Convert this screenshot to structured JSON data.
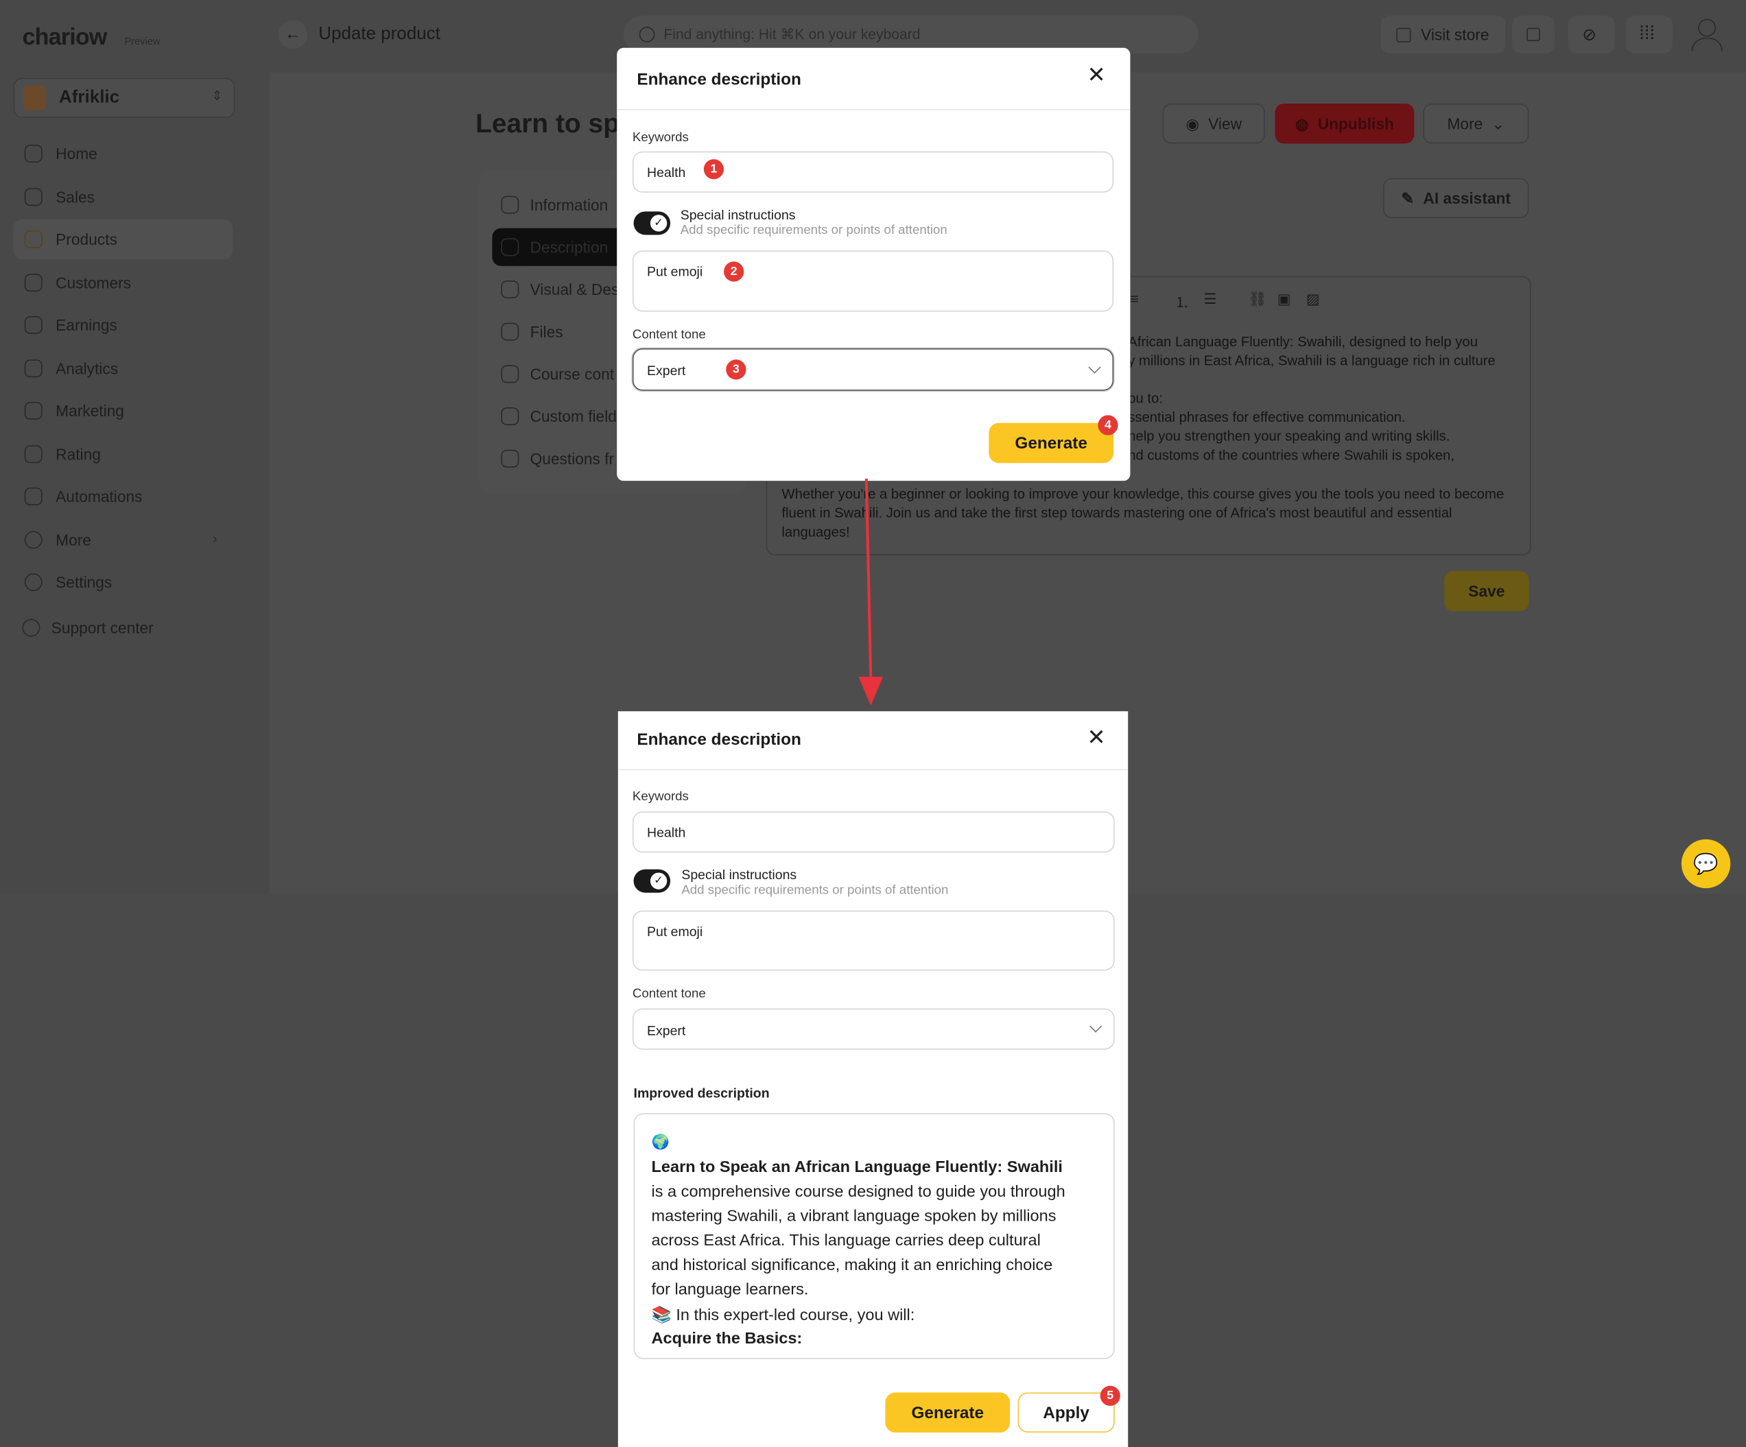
{
  "app": {
    "logo": "chariow",
    "logo_tag": "Preview",
    "store_name": "Afriklic",
    "page_header": "Update product",
    "search_placeholder": "Find anything: Hit ⌘K on your keyboard",
    "visit_store": "Visit store",
    "nav": [
      {
        "label": "Home",
        "icon": "home-icon"
      },
      {
        "label": "Sales",
        "icon": "sales-icon"
      },
      {
        "label": "Products",
        "icon": "box-icon"
      },
      {
        "label": "Customers",
        "icon": "users-icon"
      },
      {
        "label": "Earnings",
        "icon": "earnings-icon"
      },
      {
        "label": "Analytics",
        "icon": "chart-icon"
      },
      {
        "label": "Marketing",
        "icon": "megaphone-icon"
      },
      {
        "label": "Rating",
        "icon": "rating-icon"
      },
      {
        "label": "Automations",
        "icon": "bolt-icon"
      },
      {
        "label": "More",
        "icon": "more-icon"
      },
      {
        "label": "Settings",
        "icon": "gear-icon"
      }
    ],
    "support": "Support center",
    "product_title": "Learn to spe",
    "view_button": "View",
    "unpublish_button": "Unpublish",
    "more_button": "More",
    "ai_assistant": "AI assistant",
    "tabs": [
      {
        "label": "Information"
      },
      {
        "label": "Description"
      },
      {
        "label": "Visual & Des"
      },
      {
        "label": "Files"
      },
      {
        "label": "Course cont"
      },
      {
        "label": "Custom field"
      },
      {
        "label": "Questions fr"
      }
    ],
    "editor_lines": [
      "African Language Fluently: Swahili, designed to help you",
      "y millions in East Africa, Swahili is a language rich in culture",
      "ou to:",
      "ssential phrases for effective communication.",
      "help you strengthen your speaking and writing skills.",
      "nd customs of the countries where Swahili is spoken,",
      "Whether you're a beginner or looking to improve your knowledge, this course gives you the tools you need to become",
      "fluent in Swahili. Join us and take the first step towards mastering one of Africa's most beautiful and essential",
      "languages!"
    ],
    "save_button": "Save"
  },
  "modal1": {
    "title": "Enhance description",
    "keywords_label": "Keywords",
    "keywords_value": "Health",
    "special_title": "Special instructions",
    "special_sub": "Add specific requirements or points of attention",
    "instructions_value": "Put emoji",
    "tone_label": "Content tone",
    "tone_value": "Expert",
    "generate_button": "Generate",
    "markers": [
      "1",
      "2",
      "3",
      "4"
    ]
  },
  "modal2": {
    "title": "Enhance description",
    "keywords_label": "Keywords",
    "keywords_value": "Health",
    "special_title": "Special instructions",
    "special_sub": "Add specific requirements or points of attention",
    "instructions_value": "Put emoji",
    "tone_label": "Content tone",
    "tone_value": "Expert",
    "improved_label": "Improved description",
    "improved_lines": [
      "🌍",
      "Learn to Speak an African Language Fluently: Swahili",
      "is a comprehensive course designed to guide you through",
      "mastering Swahili, a vibrant language spoken by millions",
      "across East Africa. This language carries deep cultural",
      "and historical significance, making it an enriching choice",
      "for language learners.",
      "📚 In this expert-led course, you will:",
      "Acquire the Basics:"
    ],
    "generate_button": "Generate",
    "apply_button": "Apply",
    "marker": "5"
  },
  "colors": {
    "accent": "#fbc623",
    "marker": "#e53935",
    "arrow": "#e8323c",
    "overlay": "#4a4a4a"
  }
}
